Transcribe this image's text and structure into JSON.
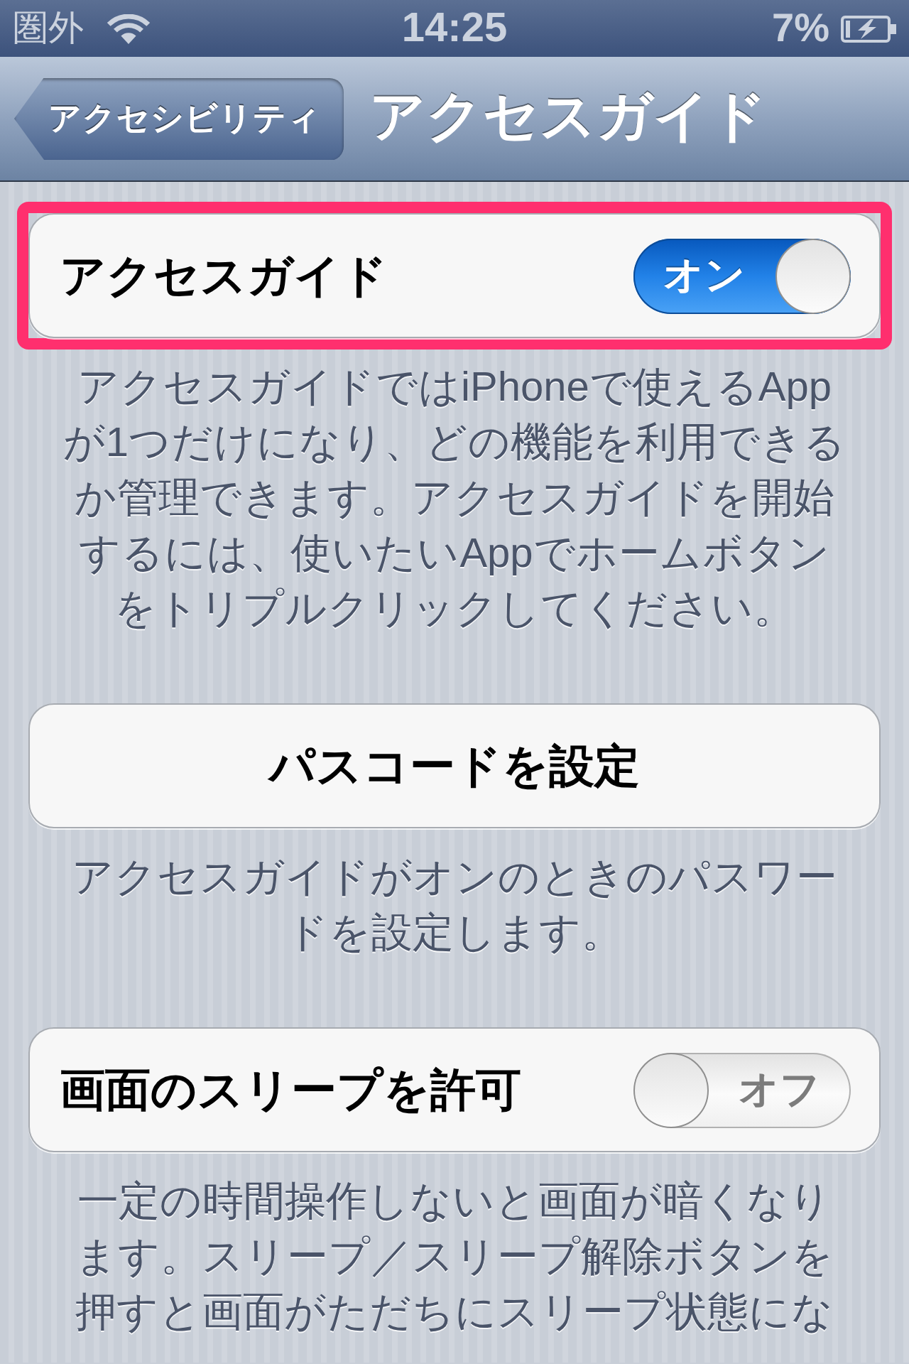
{
  "status_bar": {
    "carrier": "圏外",
    "time": "14:25",
    "battery": "7%"
  },
  "nav_bar": {
    "back_button": "アクセシビリティ",
    "title": "アクセスガイド"
  },
  "groups": [
    {
      "kind": "switch",
      "label": "アクセスガイド",
      "on": true,
      "switch_text": "オン",
      "highlighted": true,
      "footer": "アクセスガイドではiPhoneで使えるAppが1つだけになり、どの機能を利用できるか管理できます。アクセスガイドを開始するには、使いたいAppでホームボタンをトリプルクリックしてください。"
    },
    {
      "kind": "button",
      "label": "パスコードを設定",
      "footer": "アクセスガイドがオンのときのパスワードを設定します。"
    },
    {
      "kind": "switch",
      "label": "画面のスリープを許可",
      "on": false,
      "switch_text": "オフ",
      "highlighted": false,
      "footer": "一定の時間操作しないと画面が暗くなります。スリープ／スリープ解除ボタンを押すと画面がただちにスリープ状態にな"
    }
  ]
}
